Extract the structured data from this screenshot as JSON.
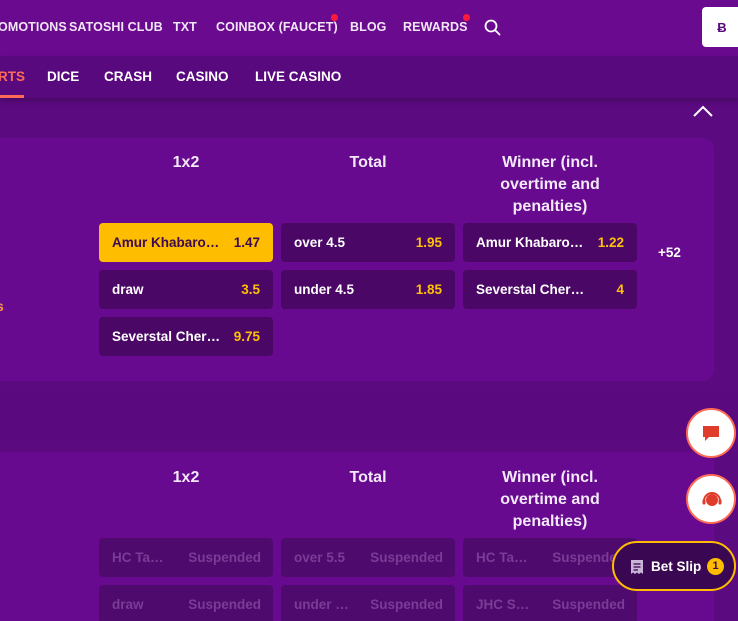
{
  "topnav": {
    "links": [
      "OMOTIONS",
      "SATOSHI CLUB",
      "TXT",
      "COINBOX (FAUCET)",
      "BLOG",
      "REWARDS"
    ],
    "wallet_symbol": "Ƀ"
  },
  "gamenav": {
    "tabs": [
      "RTS",
      "DICE",
      "CRASH",
      "CASINO",
      "LIVE CASINO"
    ],
    "active_index": 0
  },
  "events": [
    {
      "columns": [
        "1x2",
        "Total",
        "Winner (incl. overtime and penalties)"
      ],
      "markets": {
        "x12": [
          {
            "label": "Amur Khabarovsk",
            "odd": "1.47",
            "selected": true
          },
          {
            "label": "draw",
            "odd": "3.5"
          },
          {
            "label": "Severstal Cherepovets",
            "odd": "9.75"
          }
        ],
        "total": [
          {
            "label": "over 4.5",
            "odd": "1.95"
          },
          {
            "label": "under 4.5",
            "odd": "1.85"
          }
        ],
        "winner": [
          {
            "label": "Amur Khabarovsk",
            "odd": "1.22"
          },
          {
            "label": "Severstal Cherepovets",
            "odd": "4"
          }
        ]
      },
      "more_markets": "+52",
      "edge_fragment": "s"
    },
    {
      "columns": [
        "1x2",
        "Total",
        "Winner (incl. overtime and penalties)"
      ],
      "markets": {
        "x12": [
          {
            "label": "HC Tai…",
            "odd": "Suspended"
          },
          {
            "label": "draw",
            "odd": "Suspended"
          }
        ],
        "total": [
          {
            "label": "over 5.5",
            "odd": "Suspended"
          },
          {
            "label": "under …",
            "odd": "Suspended"
          }
        ],
        "winner": [
          {
            "label": "HC Tai…",
            "odd": "Suspended"
          },
          {
            "label": "JHC S…",
            "odd": "Suspended"
          }
        ]
      }
    }
  ],
  "betslip": {
    "label": "Bet Slip",
    "count": "1"
  },
  "colors": {
    "accent": "#ff6b57",
    "odds": "#ffc107",
    "selected": "#ffbd00",
    "bg": "#5b0a80"
  }
}
